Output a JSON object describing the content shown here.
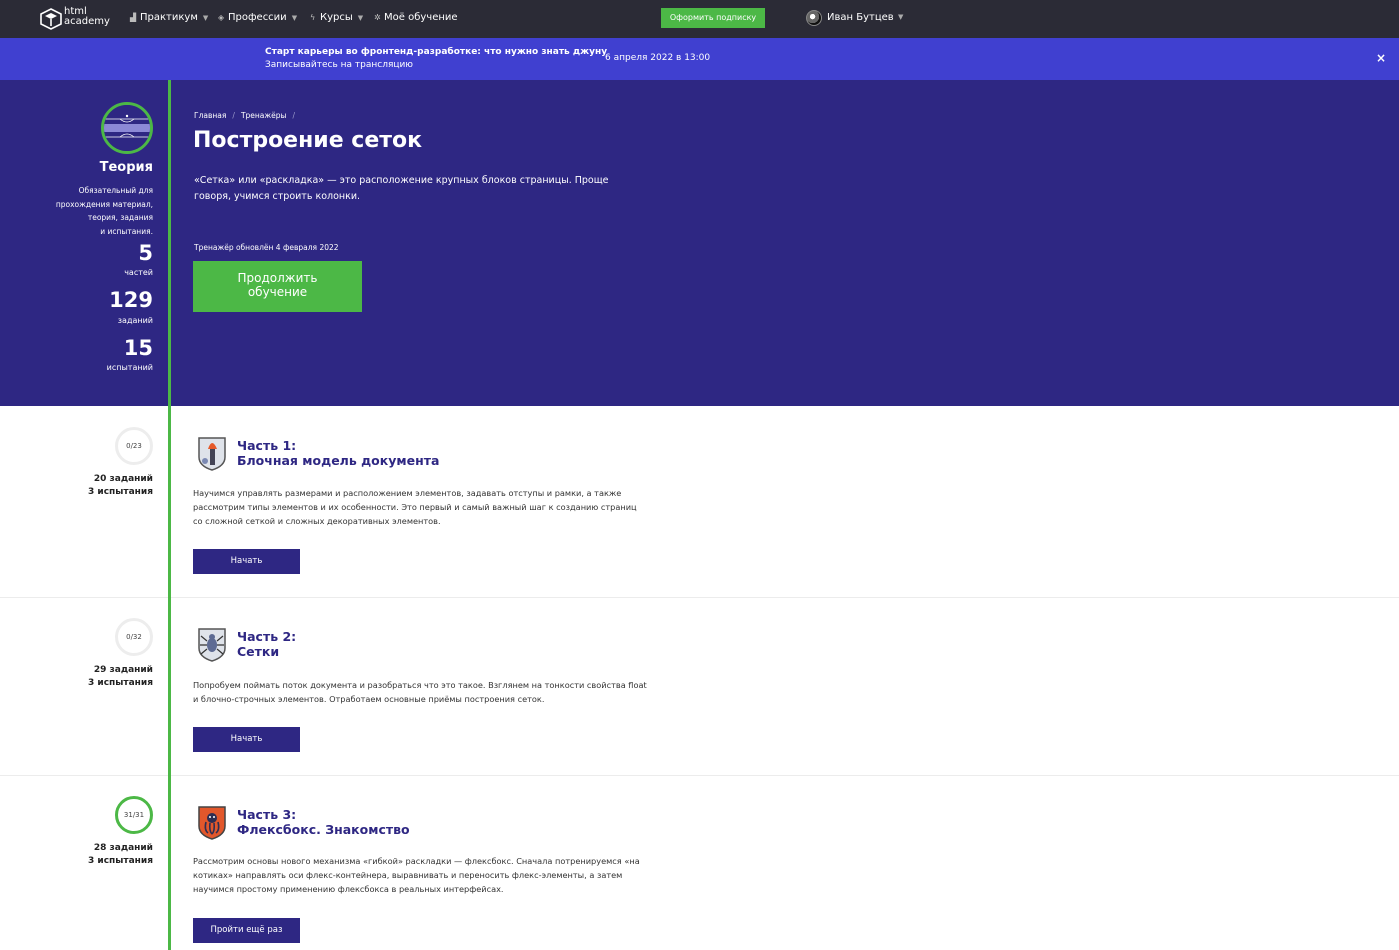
{
  "nav": {
    "logo_line1": "html",
    "logo_line2": "academy",
    "items": [
      {
        "label": "Практикум",
        "icon": "chart-icon"
      },
      {
        "label": "Профессии",
        "icon": "cube-icon"
      },
      {
        "label": "Курсы",
        "icon": "bolt-icon"
      },
      {
        "label": "Моё обучение",
        "icon": "gear-icon"
      }
    ],
    "subscribe": "Оформить подписку",
    "user": "Иван Бутцев"
  },
  "banner": {
    "title": "Старт карьеры во фронтенд-разработке: что нужно знать джуну",
    "subtitle": "Записывайтесь на трансляцию",
    "date": "6 апреля 2022 в 13:00",
    "close": "×"
  },
  "hero": {
    "theory_title": "Теория",
    "theory_desc": [
      "Обязательный для",
      "прохождения материал,",
      "теория, задания",
      "и испытания."
    ],
    "stats": [
      {
        "num": "5",
        "label": "частей"
      },
      {
        "num": "129",
        "label": "заданий"
      },
      {
        "num": "15",
        "label": "испытаний"
      }
    ],
    "breadcrumb": [
      "Главная",
      "Тренажёры"
    ],
    "title": "Построение сеток",
    "description": "«Сетка» или «раскладка» — это расположение крупных блоков страницы. Проще говоря, учимся строить колонки.",
    "updated": "Тренажёр обновлён 4 февраля 2022",
    "continue_line1": "Продолжить",
    "continue_line2": "обучение"
  },
  "parts": [
    {
      "progress": "0/23",
      "tasks": "20 заданий",
      "trials": "3 испытания",
      "title1": "Часть 1:",
      "title2": "Блочная модель документа",
      "description": "Научимся управлять размерами и расположением элементов, задавать отступы и рамки, а также рассмотрим типы элементов и их особенности. Это первый и самый важный шаг к созданию страниц со сложной сеткой и сложных декоративных элементов.",
      "button": "Начать",
      "icon": "torch-shield-icon",
      "completed": false
    },
    {
      "progress": "0/32",
      "tasks": "29 заданий",
      "trials": "3 испытания",
      "title1": "Часть 2:",
      "title2": "Сетки",
      "description": "Попробуем поймать поток документа и разобраться что это такое. Взглянем на тонкости свойства float и блочно-строчных элементов. Отработаем основные приёмы построения сеток.",
      "button": "Начать",
      "icon": "spider-shield-icon",
      "completed": false
    },
    {
      "progress": "31/31",
      "tasks": "28 заданий",
      "trials": "3 испытания",
      "title1": "Часть 3:",
      "title2": "Флексбокс. Знакомство",
      "description": "Рассмотрим основы нового механизма «гибкой» раскладки — флексбокс. Сначала потренируемся «на котиках» направлять оси флекс-контейнера, выравнивать и переносить флекс-элементы, а затем научимся простому применению флексбокса в реальных интерфейсах.",
      "button": "Пройти ещё раз",
      "icon": "octopus-shield-icon",
      "completed": true
    }
  ],
  "colors": {
    "nav_bg": "#2b2b36",
    "banner_bg": "#4040d0",
    "hero_bg": "#2e2783",
    "accent_green": "#4cb846",
    "part_title": "#2e2783"
  }
}
